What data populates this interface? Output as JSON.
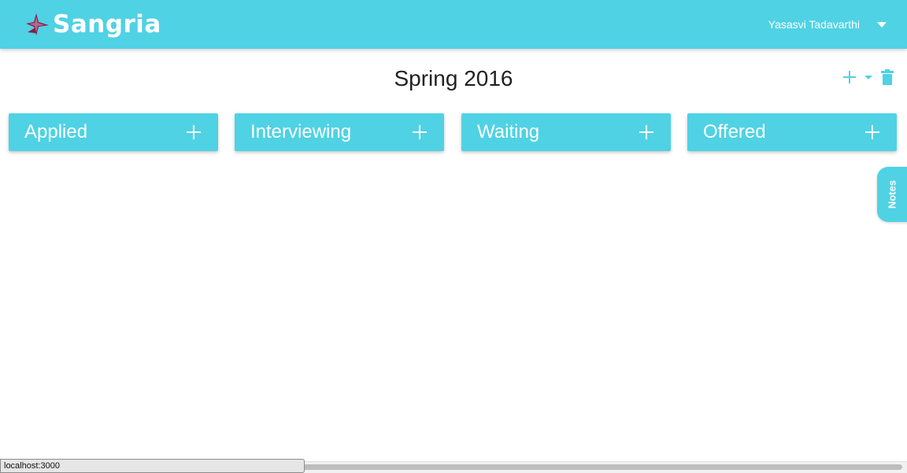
{
  "app": {
    "name": "Sangria",
    "accent_color": "#4fd2e4",
    "logo_mark_color": "#8b1a4a",
    "logo_icon": "bird-icon"
  },
  "header": {
    "user_name": "Yasasvi Tadavarthi",
    "user_menu_icon": "caret-down-icon"
  },
  "semester": {
    "title": "Spring 2016",
    "actions": [
      {
        "name": "add-semester",
        "icon": "plus-icon"
      },
      {
        "name": "semester-dropdown",
        "icon": "caret-down-icon"
      },
      {
        "name": "delete-semester",
        "icon": "trash-icon"
      }
    ]
  },
  "columns": [
    {
      "label": "Applied",
      "add_icon": "plus-icon"
    },
    {
      "label": "Interviewing",
      "add_icon": "plus-icon"
    },
    {
      "label": "Waiting",
      "add_icon": "plus-icon"
    },
    {
      "label": "Offered",
      "add_icon": "plus-icon"
    }
  ],
  "notes_tab": {
    "label": "Notes"
  },
  "status_bar": {
    "url": "localhost:3000"
  }
}
